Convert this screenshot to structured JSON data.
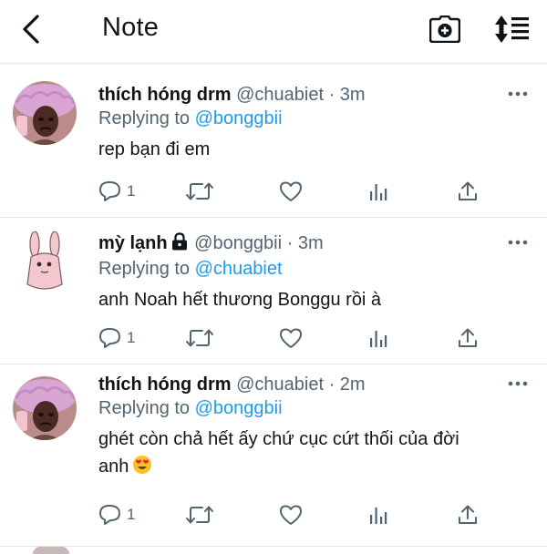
{
  "header": {
    "title": "Note",
    "back_icon": "chevron-left-icon",
    "camera_icon": "camera-add-icon",
    "sort_icon": "sort-icon"
  },
  "tweets": [
    {
      "name": "thích hóng drm",
      "handle": "@chuabiet",
      "time": "· 3m",
      "replying_prefix": "Replying to",
      "replying_to": "@bonggbii",
      "text": "rep bạn đi em",
      "reply_count": "1",
      "locked": false
    },
    {
      "name": "mỳ lạnh",
      "handle": "@bonggbii",
      "time": "· 3m",
      "replying_prefix": "Replying to",
      "replying_to": "@chuabiet",
      "text": "anh Noah hết thương Bonggu rồi à",
      "reply_count": "1",
      "locked": true
    },
    {
      "name": "thích hóng drm",
      "handle": "@chuabiet",
      "time": "· 2m",
      "replying_prefix": "Replying to",
      "replying_to": "@bonggbii",
      "text_line1": "ghét còn chả hết ấy chứ cục cứt thối của đời",
      "text_line2": "anh",
      "emoji": "heart-eyes-emoji",
      "reply_count": "1",
      "locked": false
    }
  ],
  "colors": {
    "text": "#0f1419",
    "secondary": "#536471",
    "link": "#1d9bf0",
    "divider": "#e6e9eb"
  }
}
